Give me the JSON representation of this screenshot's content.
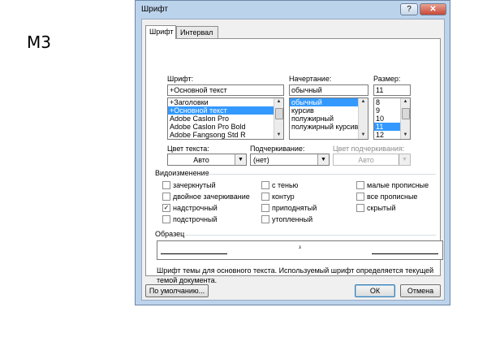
{
  "slide": {
    "label": "М3"
  },
  "window": {
    "title": "Шрифт",
    "help_glyph": "?",
    "close_glyph": "✕"
  },
  "tabs": [
    {
      "label": "Шрифт",
      "active": true
    },
    {
      "label": "Интервал",
      "active": false
    }
  ],
  "font": {
    "label": "Шрифт:",
    "value": "+Основной текст",
    "items": [
      "+Заголовки",
      "+Основной текст",
      "Adobe Caslon Pro",
      "Adobe Caslon Pro Bold",
      "Adobe Fangsong Std R"
    ],
    "selected_index": 1
  },
  "style": {
    "label": "Начертание:",
    "value": "обычный",
    "items": [
      "обычный",
      "курсив",
      "полужирный",
      "полужирный курсив"
    ],
    "selected_index": 0
  },
  "size": {
    "label": "Размер:",
    "value": "11",
    "items": [
      "8",
      "9",
      "10",
      "11",
      "12"
    ],
    "selected_index": 3
  },
  "color": {
    "label": "Цвет текста:",
    "value": "Авто"
  },
  "underline": {
    "label": "Подчеркивание:",
    "value": "(нет)"
  },
  "underline_color": {
    "label": "Цвет подчеркивания:",
    "value": "Авто"
  },
  "effects": {
    "title": "Видоизменение",
    "items": [
      {
        "label": "зачеркнутый",
        "checked": false
      },
      {
        "label": "двойное зачеркивание",
        "checked": false
      },
      {
        "label": "надстрочный",
        "checked": true
      },
      {
        "label": "подстрочный",
        "checked": false
      },
      {
        "label": "с тенью",
        "checked": false
      },
      {
        "label": "контур",
        "checked": false
      },
      {
        "label": "приподнятый",
        "checked": false
      },
      {
        "label": "утопленный",
        "checked": false
      },
      {
        "label": "малые прописные",
        "checked": false
      },
      {
        "label": "все прописные",
        "checked": false
      },
      {
        "label": "скрытый",
        "checked": false
      }
    ]
  },
  "preview": {
    "title": "Образец",
    "sample": "з",
    "description": "Шрифт темы для основного текста. Используемый шрифт определяется текущей темой документа."
  },
  "buttons": {
    "default": "По умолчанию...",
    "ok": "ОК",
    "cancel": "Отмена"
  }
}
